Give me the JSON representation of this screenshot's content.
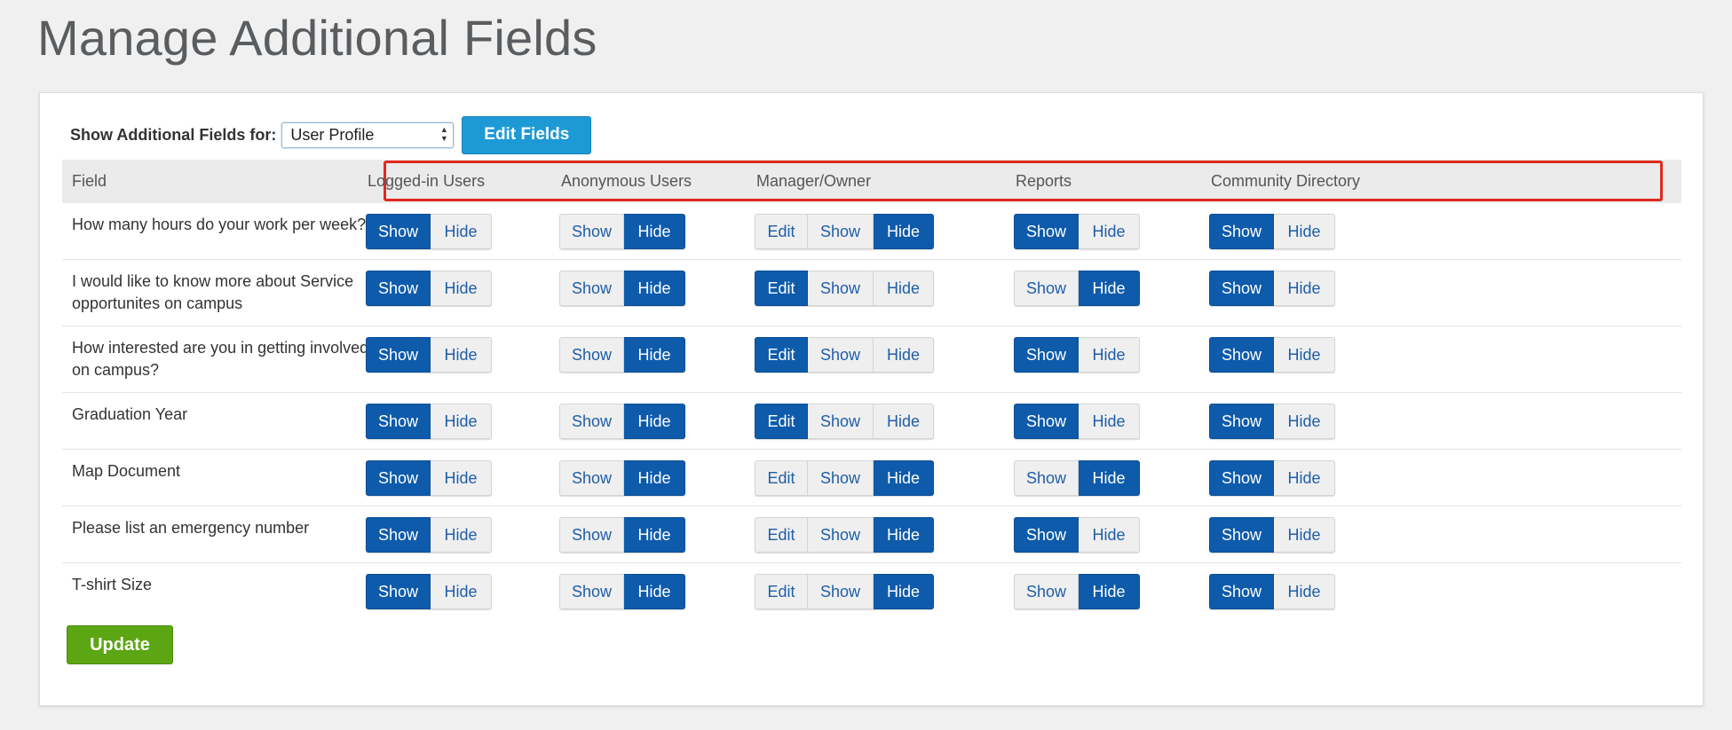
{
  "page": {
    "title": "Manage Additional Fields"
  },
  "filter": {
    "label": "Show Additional Fields for:",
    "selected": "User Profile",
    "edit_button": "Edit Fields"
  },
  "table": {
    "field_header": "Field",
    "columns": [
      {
        "label": "Logged-in Users",
        "options": [
          "Show",
          "Hide"
        ]
      },
      {
        "label": "Anonymous Users",
        "options": [
          "Show",
          "Hide"
        ]
      },
      {
        "label": "Manager/Owner",
        "options": [
          "Edit",
          "Show",
          "Hide"
        ]
      },
      {
        "label": "Reports",
        "options": [
          "Show",
          "Hide"
        ]
      },
      {
        "label": "Community Directory",
        "options": [
          "Show",
          "Hide"
        ]
      }
    ],
    "rows": [
      {
        "field": "How many hours do your work per week?",
        "states": [
          "Show",
          "Hide",
          "Hide",
          "Show",
          "Show"
        ]
      },
      {
        "field": "I would like to know more about Service opportunites on campus",
        "states": [
          "Show",
          "Hide",
          "Edit",
          "Hide",
          "Show"
        ]
      },
      {
        "field": "How interested are you in getting involved on campus?",
        "states": [
          "Show",
          "Hide",
          "Edit",
          "Show",
          "Show"
        ]
      },
      {
        "field": "Graduation Year",
        "states": [
          "Show",
          "Hide",
          "Edit",
          "Show",
          "Show"
        ]
      },
      {
        "field": "Map Document",
        "states": [
          "Show",
          "Hide",
          "Hide",
          "Hide",
          "Show"
        ]
      },
      {
        "field": "Please list an emergency number",
        "states": [
          "Show",
          "Hide",
          "Hide",
          "Show",
          "Show"
        ]
      },
      {
        "field": "T-shirt Size",
        "states": [
          "Show",
          "Hide",
          "Hide",
          "Hide",
          "Show"
        ]
      }
    ]
  },
  "actions": {
    "update_button": "Update"
  },
  "colors": {
    "active_segment": "#0e5bab",
    "inactive_segment": "#efefef",
    "edit_fields_button": "#1d9ad6",
    "update_button": "#5da613",
    "highlight_outline": "#e0291e"
  },
  "icons": {
    "select_arrow": "updown-chevron-icon"
  }
}
